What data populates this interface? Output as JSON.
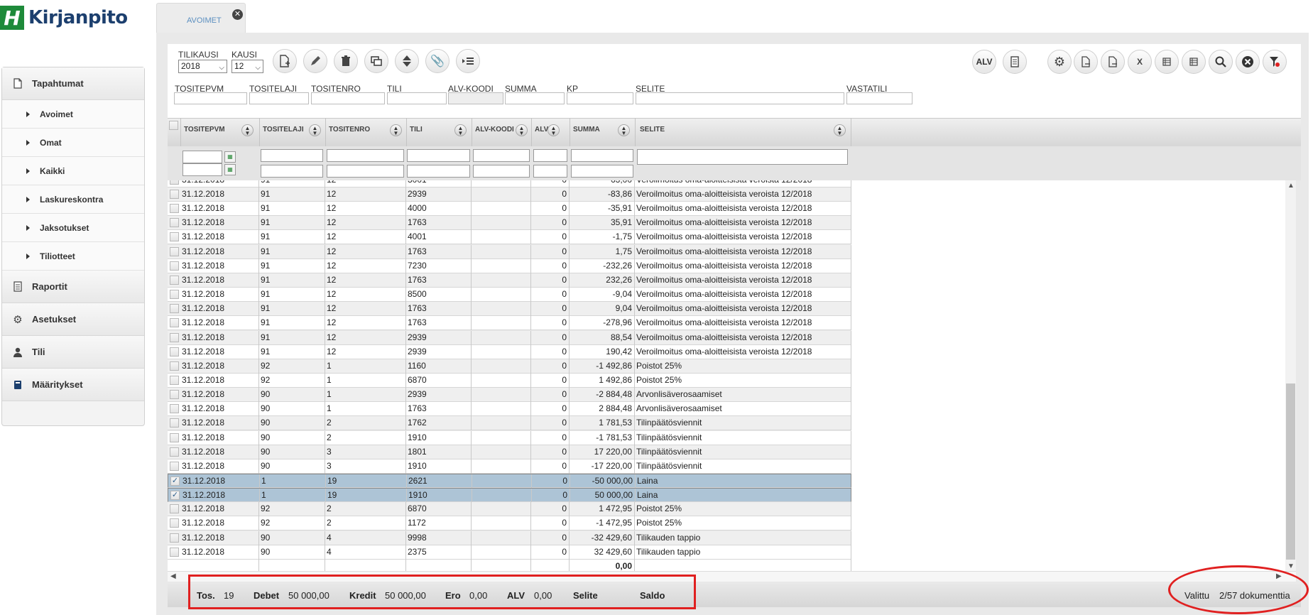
{
  "app": {
    "name": "Kirjanpito",
    "logo_letter": "H",
    "brand_color": "#1e8a3a",
    "title_color": "#1c3f6e"
  },
  "sidebar": {
    "sections": [
      {
        "label": "Tapahtumat",
        "icon": "document-icon"
      },
      {
        "label": "Raportit",
        "icon": "report-icon"
      },
      {
        "label": "Asetukset",
        "icon": "gear-icon"
      },
      {
        "label": "Tili",
        "icon": "user-icon"
      },
      {
        "label": "Määritykset",
        "icon": "book-icon"
      }
    ],
    "items": [
      "Avoimet",
      "Omat",
      "Kaikki",
      "Laskureskontra",
      "Jaksotukset",
      "Tiliotteet"
    ]
  },
  "tab": {
    "label": "AVOIMET",
    "close": "✕"
  },
  "toolbar": {
    "tilikausi_label": "TILIKAUSI",
    "tilikausi_value": "2018",
    "kausi_label": "KAUSI",
    "kausi_value": "12",
    "alv_button": "ALV",
    "left_buttons": [
      "new-document-icon",
      "edit-icon",
      "delete-icon",
      "copy-icon",
      "sort-icon",
      "attachment-icon",
      "list-indent-icon"
    ],
    "right_buttons": [
      "gear-icon",
      "export-icon",
      "export-alt-icon",
      "excel-icon",
      "table-icon",
      "table-alt-icon",
      "search-icon",
      "clear-icon",
      "filter-clear-icon"
    ]
  },
  "search_fields": [
    "TOSITEPVM",
    "TOSITELAJI",
    "TOSITENRO",
    "TILI",
    "ALV-KOODI",
    "SUMMA",
    "KP",
    "SELITE",
    "VASTATILI"
  ],
  "grid": {
    "columns": [
      "TOSITEPVM",
      "TOSITELAJI",
      "TOSITENRO",
      "TILI",
      "ALV-KOODI",
      "ALV%",
      "SUMMA",
      "SELITE"
    ],
    "partial_row": {
      "date": "31.12.2018",
      "laji": "91",
      "nro": "12",
      "tili": "3001",
      "alv": "0",
      "summa": "63,00",
      "selite": "Veroilmoitus oma-aloitteisista veroista 12/2018"
    },
    "rows": [
      {
        "date": "31.12.2018",
        "laji": "91",
        "nro": "12",
        "tili": "2939",
        "alv": "0",
        "summa": "-83,86",
        "selite": "Veroilmoitus oma-aloitteisista veroista 12/2018",
        "selected": false
      },
      {
        "date": "31.12.2018",
        "laji": "91",
        "nro": "12",
        "tili": "4000",
        "alv": "0",
        "summa": "-35,91",
        "selite": "Veroilmoitus oma-aloitteisista veroista 12/2018",
        "selected": false
      },
      {
        "date": "31.12.2018",
        "laji": "91",
        "nro": "12",
        "tili": "1763",
        "alv": "0",
        "summa": "35,91",
        "selite": "Veroilmoitus oma-aloitteisista veroista 12/2018",
        "selected": false
      },
      {
        "date": "31.12.2018",
        "laji": "91",
        "nro": "12",
        "tili": "4001",
        "alv": "0",
        "summa": "-1,75",
        "selite": "Veroilmoitus oma-aloitteisista veroista 12/2018",
        "selected": false
      },
      {
        "date": "31.12.2018",
        "laji": "91",
        "nro": "12",
        "tili": "1763",
        "alv": "0",
        "summa": "1,75",
        "selite": "Veroilmoitus oma-aloitteisista veroista 12/2018",
        "selected": false
      },
      {
        "date": "31.12.2018",
        "laji": "91",
        "nro": "12",
        "tili": "7230",
        "alv": "0",
        "summa": "-232,26",
        "selite": "Veroilmoitus oma-aloitteisista veroista 12/2018",
        "selected": false
      },
      {
        "date": "31.12.2018",
        "laji": "91",
        "nro": "12",
        "tili": "1763",
        "alv": "0",
        "summa": "232,26",
        "selite": "Veroilmoitus oma-aloitteisista veroista 12/2018",
        "selected": false
      },
      {
        "date": "31.12.2018",
        "laji": "91",
        "nro": "12",
        "tili": "8500",
        "alv": "0",
        "summa": "-9,04",
        "selite": "Veroilmoitus oma-aloitteisista veroista 12/2018",
        "selected": false
      },
      {
        "date": "31.12.2018",
        "laji": "91",
        "nro": "12",
        "tili": "1763",
        "alv": "0",
        "summa": "9,04",
        "selite": "Veroilmoitus oma-aloitteisista veroista 12/2018",
        "selected": false
      },
      {
        "date": "31.12.2018",
        "laji": "91",
        "nro": "12",
        "tili": "1763",
        "alv": "0",
        "summa": "-278,96",
        "selite": "Veroilmoitus oma-aloitteisista veroista 12/2018",
        "selected": false
      },
      {
        "date": "31.12.2018",
        "laji": "91",
        "nro": "12",
        "tili": "2939",
        "alv": "0",
        "summa": "88,54",
        "selite": "Veroilmoitus oma-aloitteisista veroista 12/2018",
        "selected": false
      },
      {
        "date": "31.12.2018",
        "laji": "91",
        "nro": "12",
        "tili": "2939",
        "alv": "0",
        "summa": "190,42",
        "selite": "Veroilmoitus oma-aloitteisista veroista 12/2018",
        "selected": false
      },
      {
        "date": "31.12.2018",
        "laji": "92",
        "nro": "1",
        "tili": "1160",
        "alv": "0",
        "summa": "-1 492,86",
        "selite": "Poistot 25%",
        "selected": false
      },
      {
        "date": "31.12.2018",
        "laji": "92",
        "nro": "1",
        "tili": "6870",
        "alv": "0",
        "summa": "1 492,86",
        "selite": "Poistot 25%",
        "selected": false
      },
      {
        "date": "31.12.2018",
        "laji": "90",
        "nro": "1",
        "tili": "2939",
        "alv": "0",
        "summa": "-2 884,48",
        "selite": "Arvonlisäverosaamiset",
        "selected": false
      },
      {
        "date": "31.12.2018",
        "laji": "90",
        "nro": "1",
        "tili": "1763",
        "alv": "0",
        "summa": "2 884,48",
        "selite": "Arvonlisäverosaamiset",
        "selected": false
      },
      {
        "date": "31.12.2018",
        "laji": "90",
        "nro": "2",
        "tili": "1762",
        "alv": "0",
        "summa": "1 781,53",
        "selite": "Tilinpäätösviennit",
        "selected": false
      },
      {
        "date": "31.12.2018",
        "laji": "90",
        "nro": "2",
        "tili": "1910",
        "alv": "0",
        "summa": "-1 781,53",
        "selite": "Tilinpäätösviennit",
        "selected": false
      },
      {
        "date": "31.12.2018",
        "laji": "90",
        "nro": "3",
        "tili": "1801",
        "alv": "0",
        "summa": "17 220,00",
        "selite": "Tilinpäätösviennit",
        "selected": false
      },
      {
        "date": "31.12.2018",
        "laji": "90",
        "nro": "3",
        "tili": "1910",
        "alv": "0",
        "summa": "-17 220,00",
        "selite": "Tilinpäätösviennit",
        "selected": false
      },
      {
        "date": "31.12.2018",
        "laji": "1",
        "nro": "19",
        "tili": "2621",
        "alv": "0",
        "summa": "-50 000,00",
        "selite": "Laina",
        "selected": true
      },
      {
        "date": "31.12.2018",
        "laji": "1",
        "nro": "19",
        "tili": "1910",
        "alv": "0",
        "summa": "50 000,00",
        "selite": "Laina",
        "selected": true
      },
      {
        "date": "31.12.2018",
        "laji": "92",
        "nro": "2",
        "tili": "6870",
        "alv": "0",
        "summa": "1 472,95",
        "selite": "Poistot 25%",
        "selected": false
      },
      {
        "date": "31.12.2018",
        "laji": "92",
        "nro": "2",
        "tili": "1172",
        "alv": "0",
        "summa": "-1 472,95",
        "selite": "Poistot 25%",
        "selected": false
      },
      {
        "date": "31.12.2018",
        "laji": "90",
        "nro": "4",
        "tili": "9998",
        "alv": "0",
        "summa": "-32 429,60",
        "selite": "Tilikauden tappio",
        "selected": false
      },
      {
        "date": "31.12.2018",
        "laji": "90",
        "nro": "4",
        "tili": "2375",
        "alv": "0",
        "summa": "32 429,60",
        "selite": "Tilikauden tappio",
        "selected": false
      }
    ],
    "total": "0,00",
    "checkmark": "✓"
  },
  "footer": {
    "tos_label": "Tos.",
    "tos_value": "19",
    "debet_label": "Debet",
    "debet_value": "50 000,00",
    "kredit_label": "Kredit",
    "kredit_value": "50 000,00",
    "ero_label": "Ero",
    "ero_value": "0,00",
    "alv_label": "ALV",
    "alv_value": "0,00",
    "selite_label": "Selite",
    "saldo_label": "Saldo",
    "valittu_label": "Valittu",
    "valittu_value": "2/57 dokumenttia"
  },
  "highlight_color": "#e02020"
}
